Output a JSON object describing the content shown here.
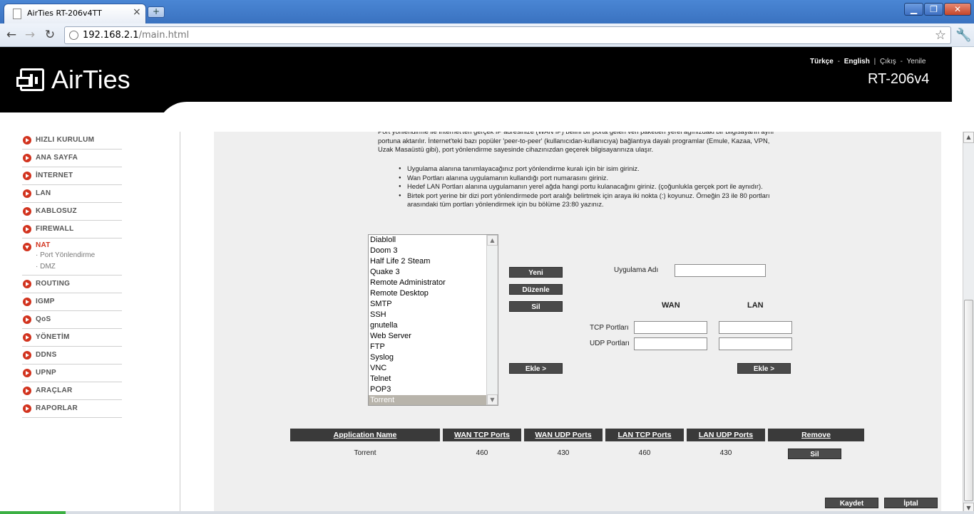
{
  "browser": {
    "tab_title": "AirTies RT-206v4TT",
    "tab_close": "×",
    "new_tab": "+",
    "url_host": "192.168.2.1",
    "url_path": "/main.html",
    "window_min": "▁",
    "window_max": "❐",
    "window_close": "✕",
    "back": "←",
    "forward": "→",
    "reload": "↻",
    "star": "☆",
    "wrench": "🔧"
  },
  "header": {
    "logo_text": "AirTies",
    "lang_tr": "Türkçe",
    "sep1": "-",
    "lang_en": "English",
    "sep2": "|",
    "logout": "Çıkış",
    "sep3": "-",
    "refresh": "Yenile",
    "model": "RT-206v4"
  },
  "sidebar": {
    "items": [
      {
        "label": "HIZLI KURULUM"
      },
      {
        "label": "ANA SAYFA"
      },
      {
        "label": "İNTERNET"
      },
      {
        "label": "LAN"
      },
      {
        "label": "KABLOSUZ"
      },
      {
        "label": "FIREWALL"
      },
      {
        "label": "NAT"
      },
      {
        "label": "ROUTING"
      },
      {
        "label": "IGMP"
      },
      {
        "label": "QoS"
      },
      {
        "label": "YÖNETİM"
      },
      {
        "label": "DDNS"
      },
      {
        "label": "UPNP"
      },
      {
        "label": "ARAÇLAR"
      },
      {
        "label": "RAPORLAR"
      }
    ],
    "nat_sub": [
      "· Port Yönlendirme",
      "· DMZ"
    ]
  },
  "content": {
    "intro": "Port yönlendirme ile internet'ten gerçek IP adresinize (WAN IP) belirli bir porta gelen veri paketleri yerel ağınızdaki bir bilgisayarın aynı portuna aktarılır. İnternet'teki bazı popüler 'peer-to-peer' (kullanıcıdan-kullanıcıya) bağlantıya dayalı programlar (Emule, Kazaa, VPN, Uzak Masaüstü gibi), port yönlendirme sayesinde cihazınızdan geçerek bilgisayarınıza ulaşır.",
    "bullets": [
      "Uygulama alanına tanımlayacağınız port yönlendirme kuralı için bir isim giriniz.",
      "Wan Portları alanına uygulamanın kullandığı port numarasını giriniz.",
      "Hedef LAN Portları alanına uygulamanın yerel ağda hangi portu kulanacağını giriniz. (çoğunlukla gerçek port ile aynıdır).",
      "Birtek port yerine bir dizi port yönlendirmede port aralığı belirtmek için araya iki nokta (:) koyunuz. Örneğin 23 ile 80 portları arasındaki tüm portları yönlendirmek için bu bölüme 23:80 yazınız."
    ],
    "apps": [
      "Diabloll",
      "Doom 3",
      "Half Life 2 Steam",
      "Quake 3",
      "Remote Administrator",
      "Remote Desktop",
      "SMTP",
      "SSH",
      "gnutella",
      "Web Server",
      "FTP",
      "Syslog",
      "VNC",
      "Telnet",
      "POP3",
      "Torrent"
    ],
    "selected_app": "Torrent",
    "btn_new": "Yeni",
    "btn_edit": "Düzenle",
    "btn_delete": "Sil",
    "btn_add_left": "Ekle >",
    "btn_add_right": "Ekle >",
    "app_name_label": "Uygulama Adı",
    "app_name_value": "",
    "wan_label": "WAN",
    "lan_label": "LAN",
    "tcp_label": "TCP Portları",
    "udp_label": "UDP Portları",
    "wan_tcp_value": "",
    "lan_tcp_value": "",
    "wan_udp_value": "",
    "lan_udp_value": ""
  },
  "table": {
    "headers": [
      "Application Name",
      "WAN TCP Ports",
      "WAN UDP Ports",
      "LAN TCP Ports",
      "LAN UDP Ports",
      "Remove"
    ],
    "rows": [
      {
        "app": "Torrent",
        "wan_tcp": "460",
        "wan_udp": "430",
        "lan_tcp": "460",
        "lan_udp": "430",
        "remove": "Sil"
      }
    ]
  },
  "footer": {
    "save": "Kaydet",
    "cancel": "İptal"
  },
  "colors": {
    "accent_red": "#d2331e",
    "header_black": "#000000",
    "button_dark": "#4a4a4a",
    "content_bg": "#efefef"
  }
}
